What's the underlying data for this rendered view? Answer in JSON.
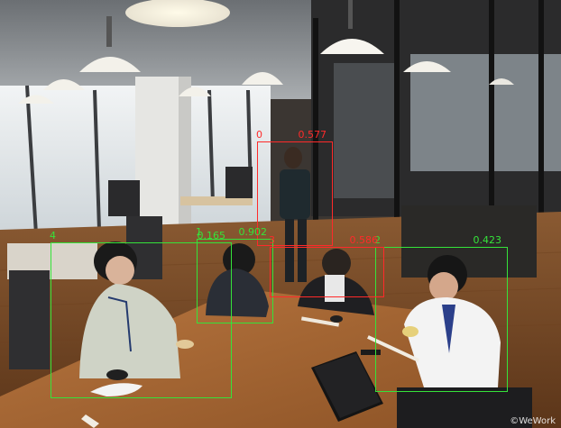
{
  "detections": [
    {
      "id": "0",
      "score": "0.577",
      "color": "#ff2a2a"
    },
    {
      "id": "1",
      "score": "0.902",
      "color": "#35e33a"
    },
    {
      "id": "2",
      "score": "0.423",
      "color": "#35e33a"
    },
    {
      "id": "3",
      "score": "0.586",
      "color": "#ff2a2a"
    },
    {
      "id": "4",
      "score": "0.165",
      "color": "#35e33a"
    }
  ],
  "watermark": "©WeWork",
  "colors": {
    "detected": "#ff2a2a",
    "tracked": "#35e33a"
  }
}
